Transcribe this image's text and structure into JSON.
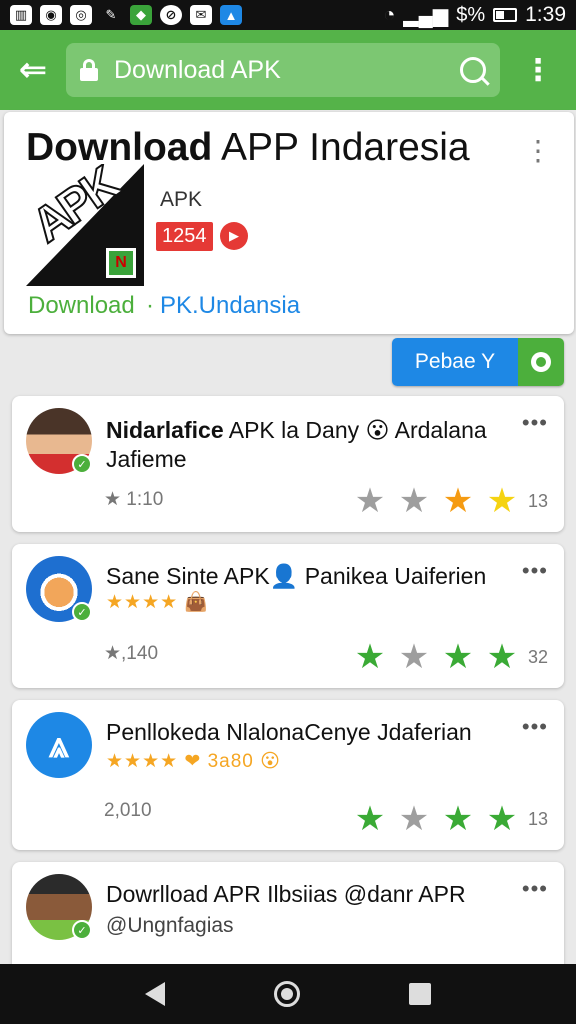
{
  "status_bar": {
    "left_icons": [
      "notification-icon",
      "camera-icon",
      "whatsapp-icon",
      "pen-icon",
      "shield-icon",
      "browser-icon",
      "mail-icon",
      "app-icon"
    ],
    "right_text": "$%",
    "time": "1:39"
  },
  "toolbar": {
    "search_text": "Download APK"
  },
  "app": {
    "title_bold": "Download",
    "title_rest": " APP Indaresia",
    "apk_label": "APK",
    "count": "1254",
    "download_link": "Download",
    "separator": "·",
    "source": "PK.Undansia"
  },
  "action_button": {
    "label": "Pebae Y"
  },
  "items": [
    {
      "title_bold": "Nidarlafice",
      "title_rest": " APK la Dany 😮 Ardalana Jafieme",
      "meta": "★ 1:10",
      "stars": [
        "gray",
        "gray",
        "orange",
        "yellow"
      ],
      "rating": "13",
      "mini": ""
    },
    {
      "title_bold": "",
      "title_rest": "Sane Sinte APK👤 Panikea Uaiferien",
      "mini": "★★★★ 👜",
      "meta": "★,140",
      "stars": [
        "green",
        "gray",
        "green",
        "green"
      ],
      "rating": "32"
    },
    {
      "title_bold": "",
      "title_rest": "Penllokeda NlalonaCenye Jdaferian",
      "mini": "★★★★ ❤ 3a80 😮",
      "meta": "2,010",
      "stars": [
        "green",
        "gray",
        "green",
        "green"
      ],
      "rating": "13"
    },
    {
      "title_bold": "",
      "title_rest": "Dowrlload APR Ilbsiias @danr APR",
      "sub": "@Ungnfagias",
      "mini": "",
      "meta": "",
      "stars": [],
      "rating": ""
    }
  ],
  "colors": {
    "toolbar": "#55b349",
    "accent_blue": "#1e88e5",
    "accent_green": "#4caf3c",
    "badge_red": "#e53935"
  }
}
